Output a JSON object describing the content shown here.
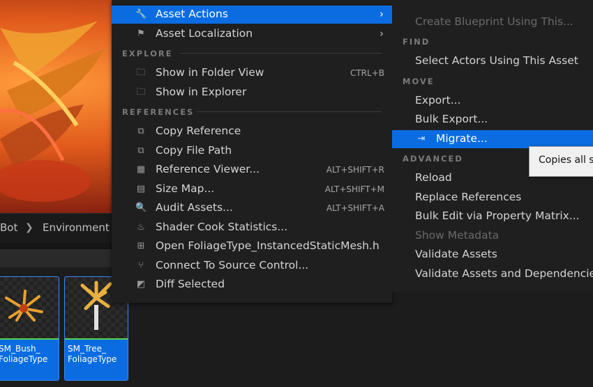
{
  "path": {
    "seg1": "Bot",
    "seg2": "Environment"
  },
  "tiles": [
    {
      "line1": "SM_Bush_",
      "line2": "FoliageType"
    },
    {
      "line1": "SM_Tree_",
      "line2": "FoliageType"
    }
  ],
  "menu": {
    "asset_actions": "Asset Actions",
    "asset_localization": "Asset Localization",
    "sec_explore": "EXPLORE",
    "folder_view": "Show in Folder View",
    "folder_view_sc": "CTRL+B",
    "explorer": "Show in Explorer",
    "sec_references": "REFERENCES",
    "copy_reference": "Copy Reference",
    "copy_file_path": "Copy File Path",
    "reference_viewer": "Reference Viewer...",
    "reference_viewer_sc": "ALT+SHIFT+R",
    "size_map": "Size Map...",
    "size_map_sc": "ALT+SHIFT+M",
    "audit_assets": "Audit Assets...",
    "audit_assets_sc": "ALT+SHIFT+A",
    "shader_cook": "Shader Cook Statistics...",
    "open_file": "Open FoliageType_InstancedStaticMesh.h",
    "connect_sc": "Connect To Source Control...",
    "diff_selected": "Diff Selected"
  },
  "submenu": {
    "create_blueprint": "Create Blueprint Using This...",
    "sec_find": "FIND",
    "select_actors": "Select Actors Using This Asset",
    "sec_move": "MOVE",
    "export": "Export...",
    "bulk_export": "Bulk Export...",
    "migrate": "Migrate...",
    "sec_advanced": "ADVANCED",
    "reload": "Reload",
    "replace_refs": "Replace References",
    "bulk_edit": "Bulk Edit via Property Matrix...",
    "show_metadata": "Show Metadata",
    "validate": "Validate Assets",
    "validate_deps": "Validate Assets and Dependencie"
  },
  "tooltip": "Copies all s",
  "colors": {
    "highlight": "#0a6ce0",
    "menu_bg": "#1f1f1f"
  }
}
